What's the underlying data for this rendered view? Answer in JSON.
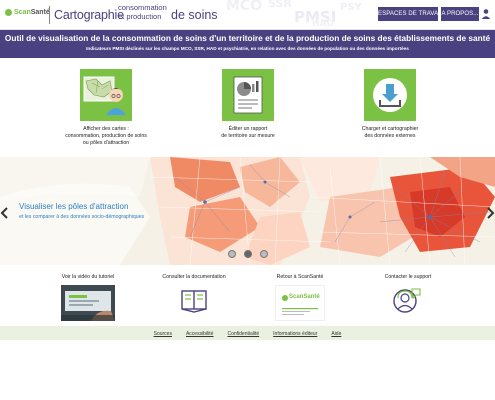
{
  "header": {
    "logo": {
      "scan": "Scan",
      "sante": "Santé"
    },
    "title_main": "Cartographie",
    "title_stack_line1": "consommation",
    "title_stack_line2": "et production",
    "title_end": "de soins",
    "nav": {
      "espaces_label": "ESPACES DE TRAVAIL",
      "apropos_label": "A PROPOS..."
    }
  },
  "banner": {
    "title": "Outil de visualisation de la consommation de soins d'un territoire et de la production de soins des établissements de santé",
    "subtitle": "Indicateurs PMSI déclinés sur les champs MCO, SSR, HAD et psychiatrie, en relation avec des données de population ou des données importées"
  },
  "features": [
    {
      "icon": "map-user-icon",
      "line1": "Afficher des cartes :",
      "line2": "consommation, production de soins",
      "line3": "ou pôles d'attraction"
    },
    {
      "icon": "report-chart-icon",
      "line1": "Éditer un rapport",
      "line2": "de territoire sur mesure",
      "line3": ""
    },
    {
      "icon": "download-icon",
      "line1": "Charger et cartographier",
      "line2": "des données externes",
      "line3": ""
    }
  ],
  "carousel": {
    "title": "Visualiser les pôles d'attraction",
    "subtitle": "et les comparer à des données socio-démographiques",
    "slide_count": 3,
    "active_slide": 1
  },
  "links": [
    {
      "label": "Voir la vidéo du tutoriel",
      "icon": "video-thumbnail"
    },
    {
      "label": "Consulter la documentation",
      "icon": "book-icon"
    },
    {
      "label": "Retour à ScanSanté",
      "icon": "scansante-logo"
    },
    {
      "label": "Contacter le support",
      "icon": "support-icon"
    }
  ],
  "scansante_logo_text": "ScanSanté",
  "footer": [
    "Sources",
    "Accessibilité",
    "Confidentialité",
    "Informations éditeur",
    "Aide"
  ],
  "colors": {
    "brand_purple": "#4a4280",
    "green": "#7bc143",
    "link_blue": "#2a7fc4",
    "footer_bg": "#eaf1e0"
  }
}
